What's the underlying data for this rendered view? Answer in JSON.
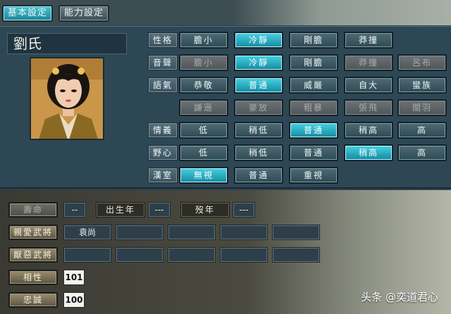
{
  "tabs": [
    {
      "label": "基本設定",
      "selected": true
    },
    {
      "label": "能力設定",
      "selected": false
    }
  ],
  "name": "劉氏",
  "rows": [
    {
      "label": "性格",
      "options": [
        {
          "label": "膽小",
          "state": "normal"
        },
        {
          "label": "冷靜",
          "state": "selected"
        },
        {
          "label": "剛膽",
          "state": "normal"
        },
        {
          "label": "莽撞",
          "state": "normal"
        }
      ]
    },
    {
      "label": "音聲",
      "options": [
        {
          "label": "膽小",
          "state": "disabled"
        },
        {
          "label": "冷靜",
          "state": "selected"
        },
        {
          "label": "剛膽",
          "state": "normal"
        },
        {
          "label": "莽撞",
          "state": "disabled"
        },
        {
          "label": "呂布",
          "state": "disabled"
        }
      ]
    },
    {
      "label": "語氣",
      "options": [
        {
          "label": "恭敬",
          "state": "normal"
        },
        {
          "label": "普通",
          "state": "selected"
        },
        {
          "label": "威嚴",
          "state": "normal"
        },
        {
          "label": "自大",
          "state": "normal"
        },
        {
          "label": "蠻族",
          "state": "normal"
        }
      ]
    },
    {
      "label": "",
      "options": [
        {
          "label": "謙遜",
          "state": "disabled"
        },
        {
          "label": "豪放",
          "state": "disabled"
        },
        {
          "label": "粗暴",
          "state": "disabled"
        },
        {
          "label": "張飛",
          "state": "disabled"
        },
        {
          "label": "關羽",
          "state": "disabled"
        }
      ]
    },
    {
      "label": "情義",
      "options": [
        {
          "label": "低",
          "state": "normal"
        },
        {
          "label": "稍低",
          "state": "normal"
        },
        {
          "label": "普通",
          "state": "selected"
        },
        {
          "label": "稍高",
          "state": "normal"
        },
        {
          "label": "高",
          "state": "normal"
        }
      ]
    },
    {
      "label": "野心",
      "options": [
        {
          "label": "低",
          "state": "normal"
        },
        {
          "label": "稍低",
          "state": "normal"
        },
        {
          "label": "普通",
          "state": "normal"
        },
        {
          "label": "稍高",
          "state": "selected"
        },
        {
          "label": "高",
          "state": "normal"
        }
      ]
    },
    {
      "label": "漢室",
      "options": [
        {
          "label": "無視",
          "state": "selected"
        },
        {
          "label": "普通",
          "state": "normal"
        },
        {
          "label": "重視",
          "state": "normal"
        }
      ]
    }
  ],
  "lifespan": {
    "label": "壽命",
    "value": "--",
    "birth_label": "出生年",
    "birth_value": "---",
    "death_label": "歿年",
    "death_value": "---"
  },
  "liked": {
    "label": "親愛武將",
    "slots": [
      "袁尚",
      "",
      "",
      "",
      ""
    ]
  },
  "disliked": {
    "label": "厭惡武將",
    "slots": [
      "",
      "",
      "",
      "",
      ""
    ]
  },
  "affinity": {
    "label": "相性",
    "value": "101"
  },
  "loyalty": {
    "label": "忠誠",
    "value": "100"
  },
  "watermark": "头条 @奕道君心"
}
